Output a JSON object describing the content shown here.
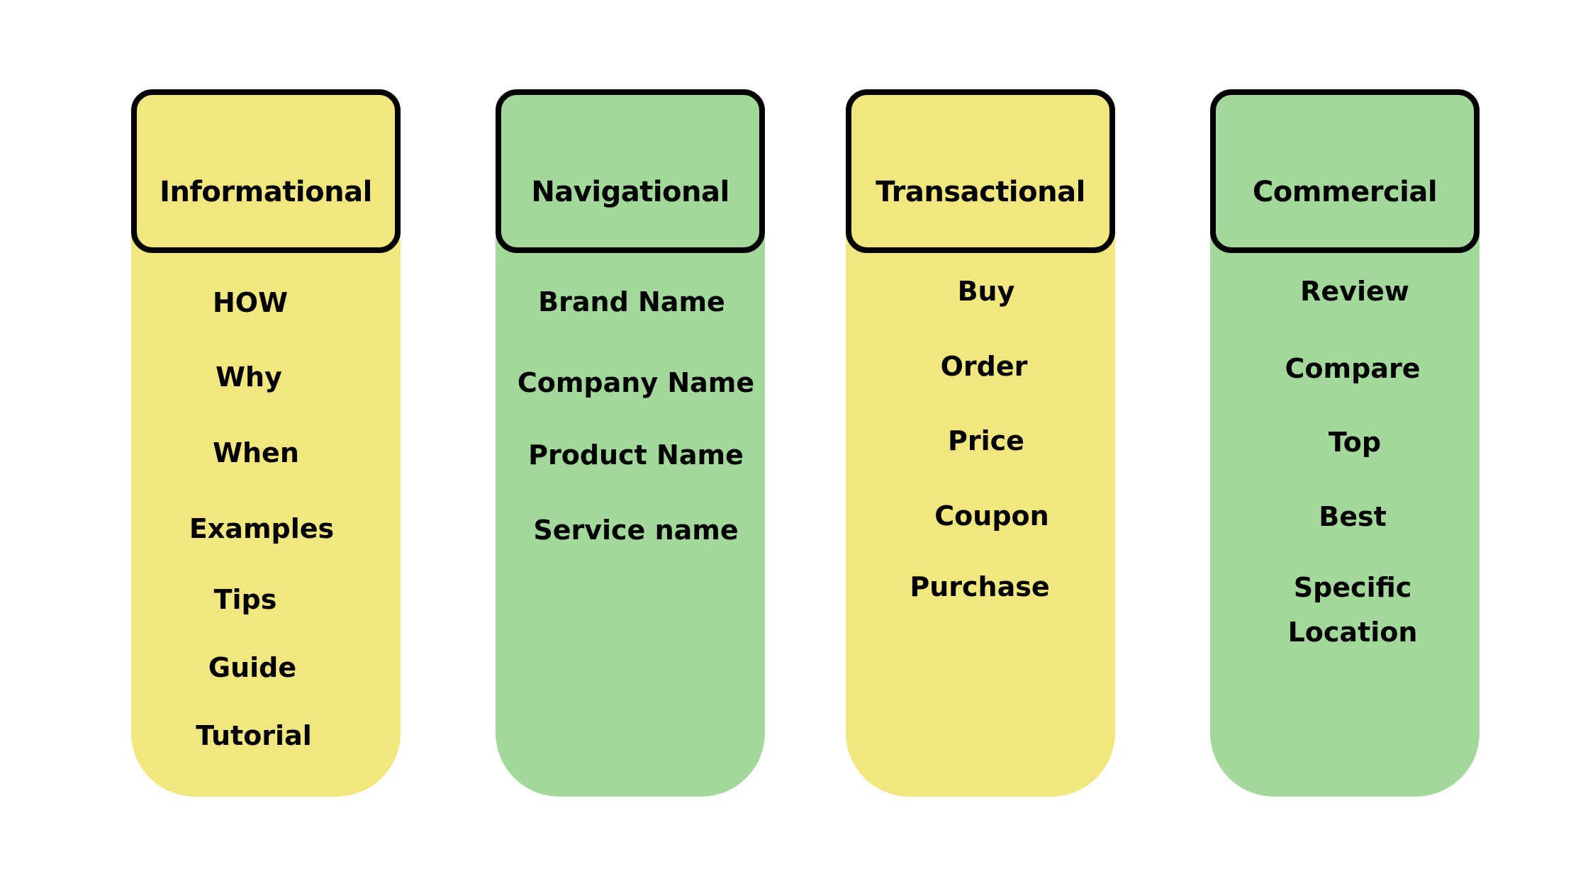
{
  "colors": {
    "yellow": "#F2E77F",
    "green": "#A2D99B",
    "border": "#000000"
  },
  "columns": [
    {
      "title": "Informational",
      "color": "yellow",
      "items": [
        "HOW",
        "Why",
        "When",
        "Examples",
        "Tips",
        "Guide",
        "Tutorial"
      ]
    },
    {
      "title": "Navigational",
      "color": "green",
      "items": [
        "Brand Name",
        "Company Name",
        "Product Name",
        "Service name"
      ]
    },
    {
      "title": "Transactional",
      "color": "yellow",
      "items": [
        "Buy",
        "Order",
        "Price",
        "Coupon",
        "Purchase"
      ]
    },
    {
      "title": "Commercial",
      "color": "green",
      "items": [
        "Review",
        "Compare",
        "Top",
        "Best",
        "Specific",
        "Location"
      ]
    }
  ]
}
